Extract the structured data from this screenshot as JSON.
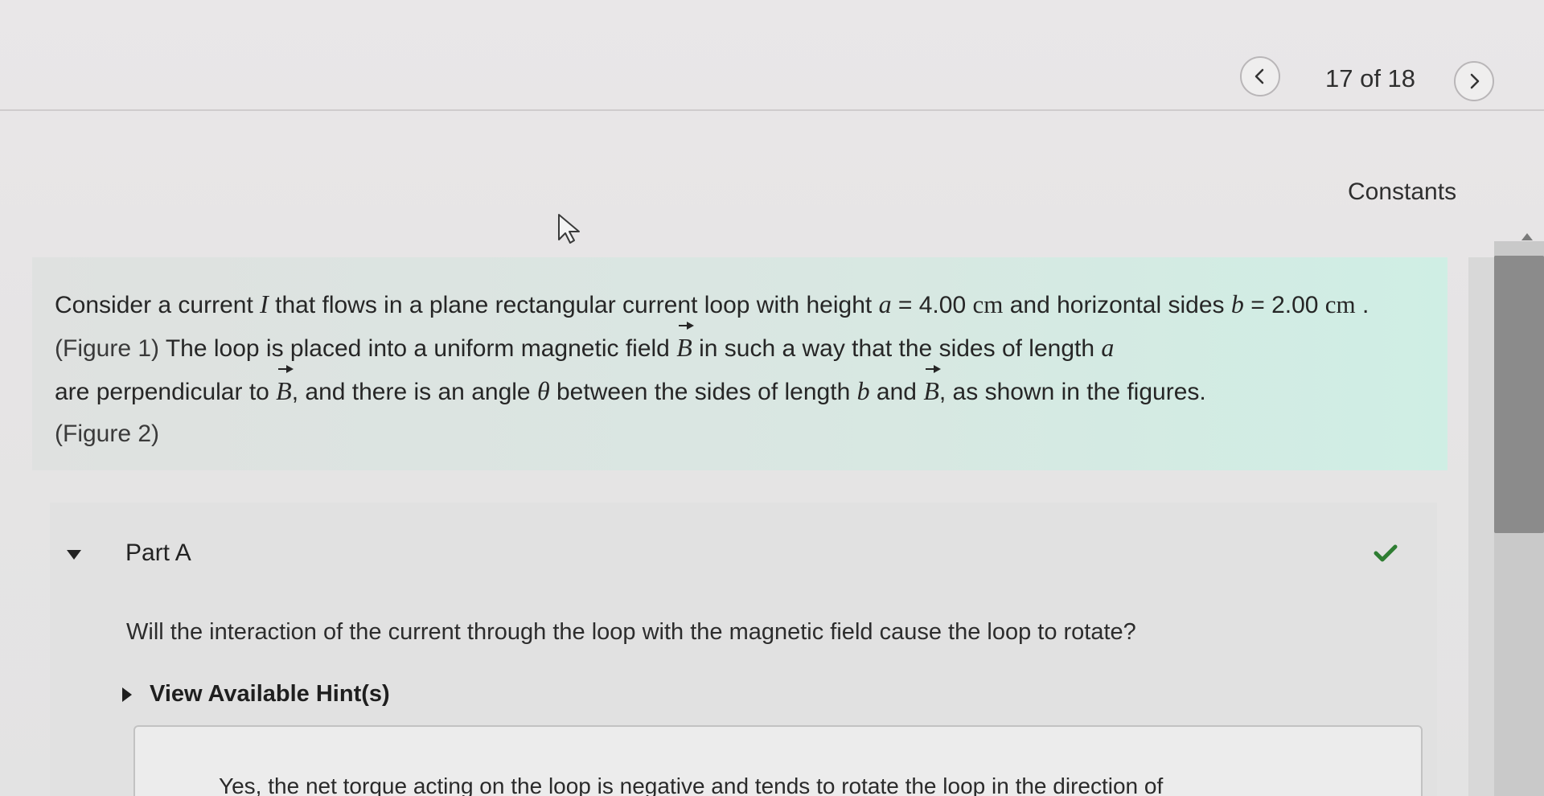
{
  "navigation": {
    "counter_text": "17 of 18",
    "prev_icon": "chevron-left-icon",
    "next_icon": "chevron-right-icon"
  },
  "constants_link": "Constants",
  "intro": {
    "text_1": "Consider a current ",
    "current_symbol": "I",
    "text_2": " that flows in a plane rectangular current loop with height ",
    "a_symbol": "a",
    "text_3": " = 4.00 ",
    "unit_cm": "cm",
    "text_4": " and horizontal sides ",
    "b_symbol": "b",
    "text_5": " = 2.00 ",
    "text_6": " . ",
    "figure1_link": "(Figure 1)",
    "text_7": " The loop is placed into a uniform magnetic field ",
    "B_symbol": "B",
    "text_8": " in such a way that the sides of length ",
    "text_9": " are perpendicular to ",
    "text_10": ", and there is an angle ",
    "theta_symbol": "θ",
    "text_11": " between the sides of length ",
    "text_12": " and ",
    "text_13": ", as shown in the figures. ",
    "figure2_link": "(Figure 2)"
  },
  "part": {
    "title": "Part A",
    "status_icon": "checkmark-icon",
    "status_color": "#2e7d32",
    "question": "Will the interaction of the current through the loop with the magnetic field cause the loop to rotate?",
    "hint_label": "View Available Hint(s)",
    "answer_option_text": "Yes, the net torque acting on the loop is negative and tends to rotate the loop in the direction of"
  }
}
